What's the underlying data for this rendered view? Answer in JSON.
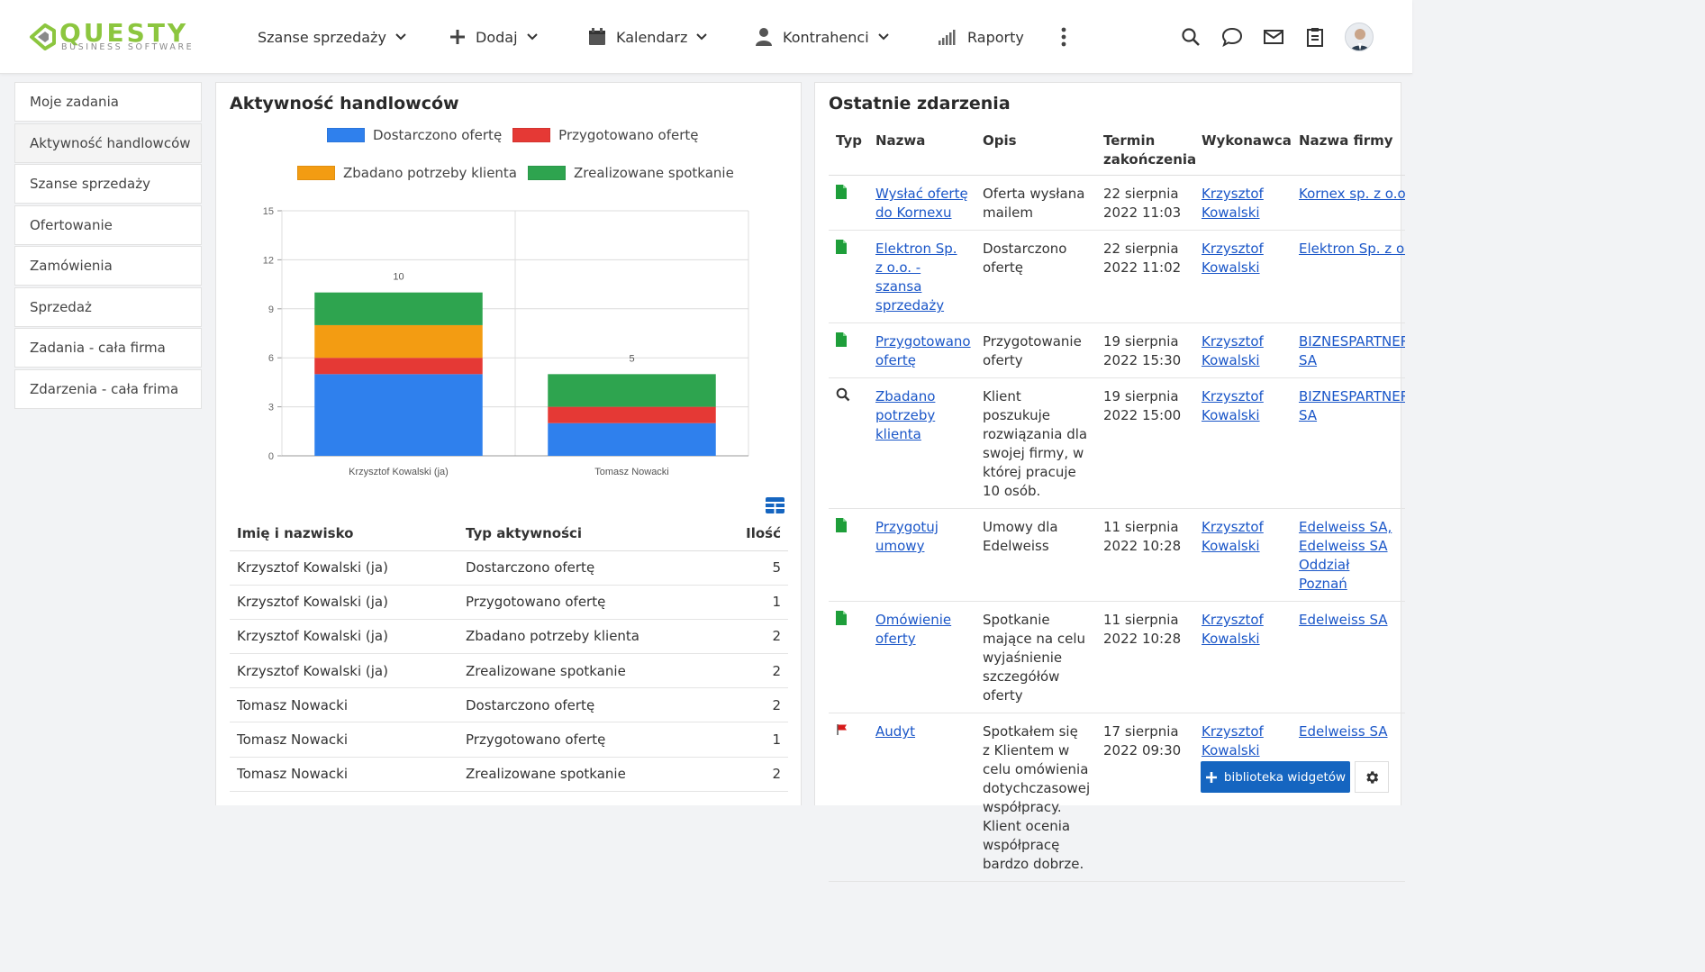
{
  "brand": {
    "name": "QUESTY",
    "tagline": "BUSINESS SOFTWARE",
    "accent": "#8cc63f"
  },
  "nav": [
    {
      "label": "Szanse sprzedaży",
      "icon": "",
      "dropdown": true
    },
    {
      "label": "Dodaj",
      "icon": "plus-icon",
      "dropdown": true
    },
    {
      "label": "Kalendarz",
      "icon": "calendar-icon",
      "dropdown": true
    },
    {
      "label": "Kontrahenci",
      "icon": "user-icon",
      "dropdown": true
    },
    {
      "label": "Raporty",
      "icon": "bar-signal-icon",
      "dropdown": false
    }
  ],
  "right_icons": [
    "search-icon",
    "chat-icon",
    "mail-icon",
    "clipboard-icon",
    "avatar"
  ],
  "sidebar": {
    "items": [
      {
        "label": "Moje zadania"
      },
      {
        "label": "Aktywność handlowców",
        "active": true
      },
      {
        "label": "Szanse sprzedaży"
      },
      {
        "label": "Ofertowanie"
      },
      {
        "label": "Zamówienia"
      },
      {
        "label": "Sprzedaż"
      },
      {
        "label": "Zadania - cała firma"
      },
      {
        "label": "Zdarzenia - cała frima"
      }
    ]
  },
  "activity": {
    "title": "Aktywność handlowców",
    "columns": {
      "name": "Imię i nazwisko",
      "type": "Typ aktywności",
      "count": "Ilość"
    },
    "rows": [
      {
        "name": "Krzysztof Kowalski (ja)",
        "type": "Dostarczono ofertę",
        "count": "5"
      },
      {
        "name": "Krzysztof Kowalski (ja)",
        "type": "Przygotowano ofertę",
        "count": "1"
      },
      {
        "name": "Krzysztof Kowalski (ja)",
        "type": "Zbadano potrzeby klienta",
        "count": "2"
      },
      {
        "name": "Krzysztof Kowalski (ja)",
        "type": "Zrealizowane spotkanie",
        "count": "2"
      },
      {
        "name": "Tomasz Nowacki",
        "type": "Dostarczono ofertę",
        "count": "2"
      },
      {
        "name": "Tomasz Nowacki",
        "type": "Przygotowano ofertę",
        "count": "1"
      },
      {
        "name": "Tomasz Nowacki",
        "type": "Zrealizowane spotkanie",
        "count": "2"
      }
    ]
  },
  "chart_data": {
    "type": "bar",
    "stacked": true,
    "categories": [
      "Krzysztof Kowalski (ja)",
      "Tomasz Nowacki"
    ],
    "series": [
      {
        "name": "Dostarczono ofertę",
        "color": "#2f80ed",
        "values": [
          5,
          2
        ]
      },
      {
        "name": "Przygotowano ofertę",
        "color": "#e53935",
        "values": [
          1,
          1
        ]
      },
      {
        "name": "Zbadano potrzeby klienta",
        "color": "#f39c12",
        "values": [
          2,
          0
        ]
      },
      {
        "name": "Zrealizowane spotkanie",
        "color": "#2ea44f",
        "values": [
          2,
          2
        ]
      }
    ],
    "totals": [
      "10",
      "5"
    ],
    "ylim": [
      0,
      15
    ],
    "yticks": [
      "0",
      "3",
      "6",
      "9",
      "12",
      "15"
    ],
    "grid": true,
    "legend": "top"
  },
  "events": {
    "title": "Ostatnie zdarzenia",
    "columns": {
      "type": "Typ",
      "name": "Nazwa",
      "desc": "Opis",
      "deadline": "Termin zakończenia",
      "owner": "Wykonawca",
      "company": "Nazwa firmy"
    },
    "rows": [
      {
        "icon": "document-icon",
        "name": "Wysłać ofertę do Kornexu",
        "desc": "Oferta wysłana mailem",
        "deadline": "22 sierpnia 2022 11:03",
        "owner": "Krzysztof Kowalski",
        "company": "Kornex sp. z o.o."
      },
      {
        "icon": "document-icon",
        "name": "Elektron Sp. z o.o. - szansa sprzedaży",
        "desc": "Dostarczono ofertę",
        "deadline": "22 sierpnia 2022 11:02",
        "owner": "Krzysztof Kowalski",
        "company": "Elektron Sp. z o.o."
      },
      {
        "icon": "document-icon",
        "name": "Przygotowano ofertę",
        "desc": "Przygotowanie oferty",
        "deadline": "19 sierpnia 2022 15:30",
        "owner": "Krzysztof Kowalski",
        "company": "BIZNESPARTNER.PL SA"
      },
      {
        "icon": "search-icon",
        "name": "Zbadano potrzeby klienta",
        "desc": "Klient poszukuje rozwiązania dla swojej firmy, w której pracuje 10 osób.",
        "deadline": "19 sierpnia 2022 15:00",
        "owner": "Krzysztof Kowalski",
        "company": "BIZNESPARTNER.PL SA"
      },
      {
        "icon": "document-icon",
        "name": "Przygotuj umowy",
        "desc": "Umowy dla Edelweiss",
        "deadline": "11 sierpnia 2022 10:28",
        "owner": "Krzysztof Kowalski",
        "company": "Edelweiss SA, Edelweiss SA Oddział Poznań"
      },
      {
        "icon": "document-icon",
        "name": "Omówienie oferty",
        "desc": "Spotkanie mające na celu wyjaśnienie szczegółów oferty",
        "deadline": "11 sierpnia 2022 10:28",
        "owner": "Krzysztof Kowalski",
        "company": "Edelweiss SA"
      },
      {
        "icon": "flag-icon",
        "name": "Audyt",
        "desc": "Spotkałem się z Klientem w celu omówienia dotychczasowej współpracy. Klient ocenia współpracę bardzo dobrze.",
        "deadline": "17 sierpnia 2022 09:30",
        "owner": "Krzysztof Kowalski",
        "company": "Edelweiss SA"
      }
    ]
  },
  "footer": {
    "widget_library": "biblioteka widgetów"
  }
}
